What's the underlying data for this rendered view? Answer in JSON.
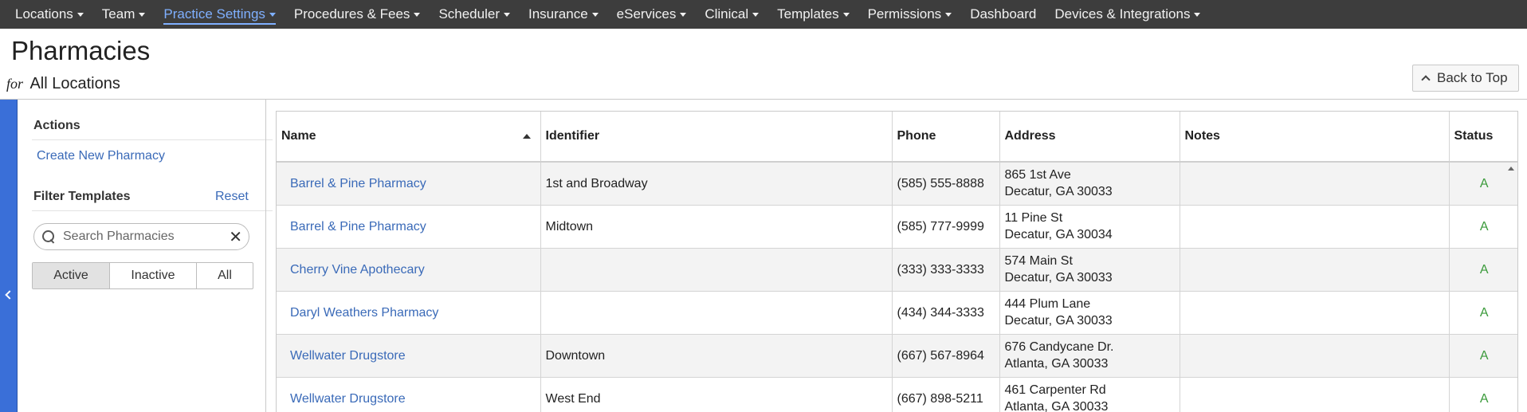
{
  "nav": {
    "items": [
      {
        "label": "Locations",
        "caret": true
      },
      {
        "label": "Team",
        "caret": true
      },
      {
        "label": "Practice Settings",
        "caret": true,
        "active": true
      },
      {
        "label": "Procedures & Fees",
        "caret": true
      },
      {
        "label": "Scheduler",
        "caret": true
      },
      {
        "label": "Insurance",
        "caret": true
      },
      {
        "label": "eServices",
        "caret": true
      },
      {
        "label": "Clinical",
        "caret": true
      },
      {
        "label": "Templates",
        "caret": true
      },
      {
        "label": "Permissions",
        "caret": true
      },
      {
        "label": "Dashboard",
        "caret": false
      },
      {
        "label": "Devices & Integrations",
        "caret": true
      }
    ]
  },
  "header": {
    "title": "Pharmacies",
    "for_label": "for",
    "location": "All Locations",
    "back_to_top": "Back to Top"
  },
  "sidebar": {
    "actions_heading": "Actions",
    "create_link": "Create New Pharmacy",
    "filter_heading": "Filter Templates",
    "reset_link": "Reset",
    "search_placeholder": "Search Pharmacies",
    "filters": [
      "Active",
      "Inactive",
      "All"
    ],
    "selected_filter": "Active"
  },
  "table": {
    "columns": [
      "Name",
      "Identifier",
      "Phone",
      "Address",
      "Notes",
      "Status"
    ],
    "sorted_by": "Name",
    "rows": [
      {
        "name": "Barrel & Pine Pharmacy",
        "identifier": "1st and Broadway",
        "phone": "(585) 555-8888",
        "address1": "865 1st Ave",
        "address2": "Decatur, GA 30033",
        "notes": "",
        "status": "A"
      },
      {
        "name": "Barrel & Pine Pharmacy",
        "identifier": "Midtown",
        "phone": "(585) 777-9999",
        "address1": "11 Pine St",
        "address2": "Decatur, GA 30034",
        "notes": "",
        "status": "A"
      },
      {
        "name": "Cherry Vine Apothecary",
        "identifier": "",
        "phone": "(333) 333-3333",
        "address1": "574 Main St",
        "address2": "Decatur, GA 30033",
        "notes": "",
        "status": "A"
      },
      {
        "name": "Daryl Weathers Pharmacy",
        "identifier": "",
        "phone": "(434) 344-3333",
        "address1": "444 Plum Lane",
        "address2": "Decatur, GA 30033",
        "notes": "",
        "status": "A"
      },
      {
        "name": "Wellwater Drugstore",
        "identifier": "Downtown",
        "phone": "(667) 567-8964",
        "address1": "676 Candycane Dr.",
        "address2": "Atlanta, GA 30033",
        "notes": "",
        "status": "A"
      },
      {
        "name": "Wellwater Drugstore",
        "identifier": "West End",
        "phone": "(667) 898-5211",
        "address1": "461 Carpenter Rd",
        "address2": "Atlanta, GA 30033",
        "notes": "",
        "status": "A"
      }
    ]
  },
  "colors": {
    "nav_bg": "#3d3d3d",
    "accent": "#3a6fd8",
    "link": "#3a6ab8",
    "status_active": "#3a9a3a"
  }
}
